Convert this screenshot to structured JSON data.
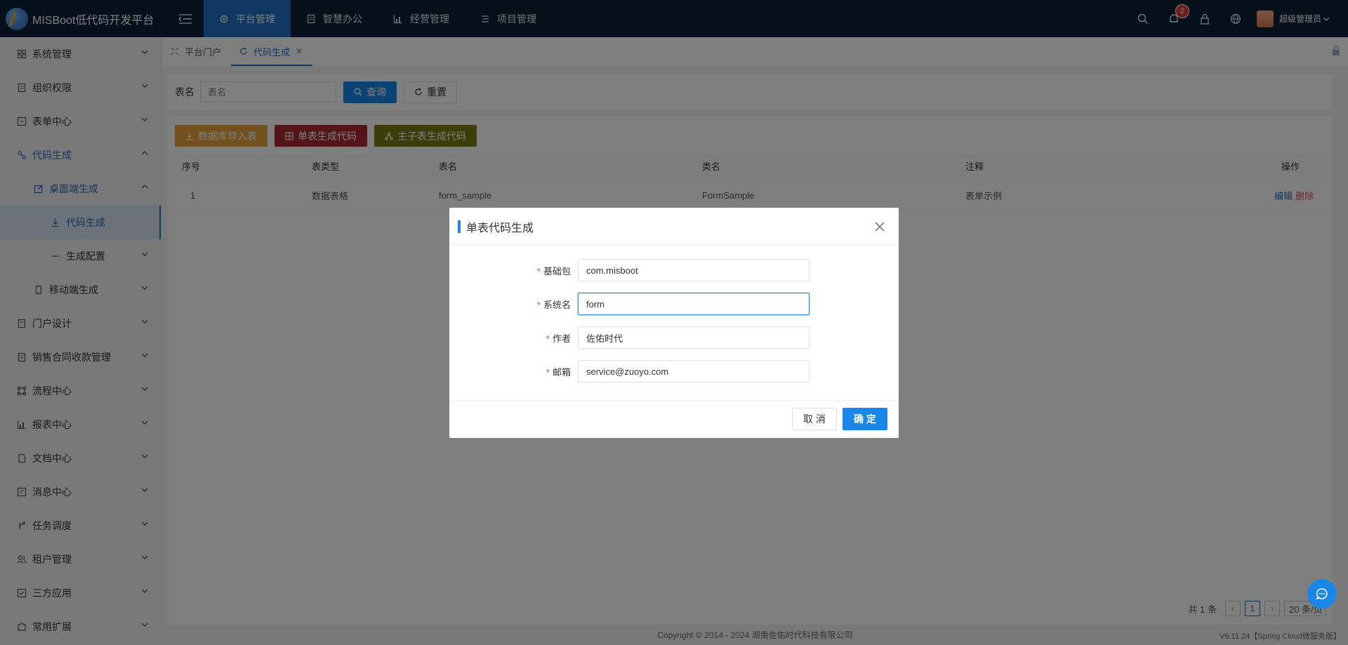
{
  "app": {
    "title": "MISBoot低代码开发平台"
  },
  "topnav": [
    {
      "label": "平台管理",
      "icon": "gear-icon"
    },
    {
      "label": "智慧办公",
      "icon": "document-icon"
    },
    {
      "label": "经营管理",
      "icon": "bar-chart-icon"
    },
    {
      "label": "项目管理",
      "icon": "list-icon"
    }
  ],
  "header": {
    "notification_count": "2",
    "user_name": "超级管理员"
  },
  "sidebar": {
    "items": [
      {
        "label": "系统管理"
      },
      {
        "label": "组织权限"
      },
      {
        "label": "表单中心"
      },
      {
        "label": "代码生成"
      },
      {
        "label": "桌面端生成"
      },
      {
        "label": "代码生成"
      },
      {
        "label": "生成配置"
      },
      {
        "label": "移动端生成"
      },
      {
        "label": "门户设计"
      },
      {
        "label": "销售合同收款管理"
      },
      {
        "label": "流程中心"
      },
      {
        "label": "报表中心"
      },
      {
        "label": "文档中心"
      },
      {
        "label": "消息中心"
      },
      {
        "label": "任务调度"
      },
      {
        "label": "租户管理"
      },
      {
        "label": "三方应用"
      },
      {
        "label": "常用扩展"
      }
    ]
  },
  "tabs": [
    {
      "label": "平台门户"
    },
    {
      "label": "代码生成"
    }
  ],
  "search": {
    "label": "表名",
    "placeholder": "表名",
    "query_label": "查询",
    "reset_label": "重置"
  },
  "toolbar": {
    "import_label": "数据库导入表",
    "single_label": "单表生成代码",
    "master_label": "主子表生成代码"
  },
  "table": {
    "columns": [
      "序号",
      "表类型",
      "表名",
      "类名",
      "注释",
      "操作"
    ],
    "rows": [
      {
        "index": "1",
        "type": "数据表格",
        "name": "form_sample",
        "class": "FormSample",
        "comment": "表单示例",
        "edit": "编辑",
        "delete": "删除"
      }
    ]
  },
  "pager": {
    "total": "共 1 条",
    "current": "1",
    "size": "20 条/页"
  },
  "footer": {
    "copyright": "Copyright © 2014 - 2024 湖南佐佑时代科技有限公司",
    "version": "V6.11.24【Spring Cloud微服务版】"
  },
  "dialog": {
    "title": "单表代码生成",
    "fields": [
      {
        "label": "基础包",
        "value": "com.misboot"
      },
      {
        "label": "系统名",
        "value": "form"
      },
      {
        "label": "作者",
        "value": "佐佑时代"
      },
      {
        "label": "邮箱",
        "value": "service@zuoyo.com"
      }
    ],
    "cancel_label": "取 消",
    "ok_label": "确 定"
  },
  "colors": {
    "topbar": "#0a2036",
    "accent": "#1a86e8",
    "warn": "#e6a23c",
    "danger": "#a92b31",
    "olive": "#7a7a12"
  }
}
